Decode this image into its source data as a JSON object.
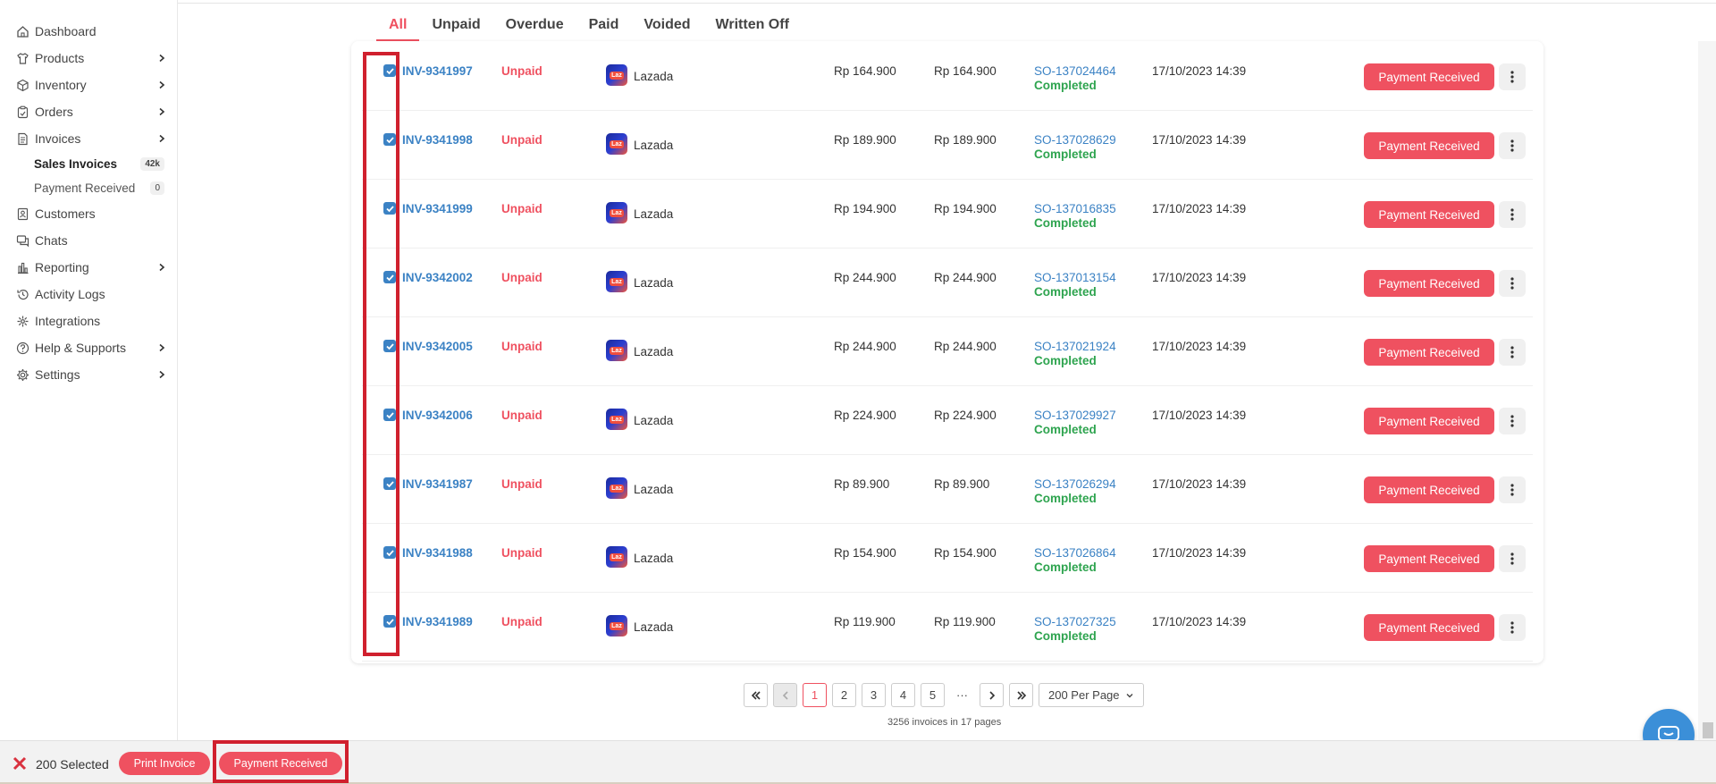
{
  "sidebar": {
    "items": [
      {
        "label": "Dashboard",
        "icon": "home-icon",
        "chevron": false
      },
      {
        "label": "Products",
        "icon": "shirt-icon",
        "chevron": true
      },
      {
        "label": "Inventory",
        "icon": "box-icon",
        "chevron": true
      },
      {
        "label": "Orders",
        "icon": "clipboard-icon",
        "chevron": true
      },
      {
        "label": "Invoices",
        "icon": "document-icon",
        "chevron": true
      }
    ],
    "sub_items": [
      {
        "label": "Sales Invoices",
        "badge": "42k"
      },
      {
        "label": "Payment Received",
        "badge": "0"
      }
    ],
    "items_after": [
      {
        "label": "Customers",
        "icon": "contact-icon",
        "chevron": false
      },
      {
        "label": "Chats",
        "icon": "chat-icon",
        "chevron": false
      },
      {
        "label": "Reporting",
        "icon": "bar-chart-icon",
        "chevron": true
      },
      {
        "label": "Activity Logs",
        "icon": "history-icon",
        "chevron": false
      },
      {
        "label": "Integrations",
        "icon": "integrations-icon",
        "chevron": false
      },
      {
        "label": "Help & Supports",
        "icon": "help-icon",
        "chevron": true
      },
      {
        "label": "Settings",
        "icon": "gear-icon",
        "chevron": true
      }
    ]
  },
  "tabs": [
    "All",
    "Unpaid",
    "Overdue",
    "Paid",
    "Voided",
    "Written Off"
  ],
  "rows": [
    {
      "invoice": "INV-9341997",
      "status": "Unpaid",
      "channel": "Lazada",
      "amount": "Rp 164.900",
      "balance": "Rp 164.900",
      "so": "SO-137024464",
      "so_status": "Completed",
      "date": "17/10/2023 14:39",
      "action": "Payment Received"
    },
    {
      "invoice": "INV-9341998",
      "status": "Unpaid",
      "channel": "Lazada",
      "amount": "Rp 189.900",
      "balance": "Rp 189.900",
      "so": "SO-137028629",
      "so_status": "Completed",
      "date": "17/10/2023 14:39",
      "action": "Payment Received"
    },
    {
      "invoice": "INV-9341999",
      "status": "Unpaid",
      "channel": "Lazada",
      "amount": "Rp 194.900",
      "balance": "Rp 194.900",
      "so": "SO-137016835",
      "so_status": "Completed",
      "date": "17/10/2023 14:39",
      "action": "Payment Received"
    },
    {
      "invoice": "INV-9342002",
      "status": "Unpaid",
      "channel": "Lazada",
      "amount": "Rp 244.900",
      "balance": "Rp 244.900",
      "so": "SO-137013154",
      "so_status": "Completed",
      "date": "17/10/2023 14:39",
      "action": "Payment Received"
    },
    {
      "invoice": "INV-9342005",
      "status": "Unpaid",
      "channel": "Lazada",
      "amount": "Rp 244.900",
      "balance": "Rp 244.900",
      "so": "SO-137021924",
      "so_status": "Completed",
      "date": "17/10/2023 14:39",
      "action": "Payment Received"
    },
    {
      "invoice": "INV-9342006",
      "status": "Unpaid",
      "channel": "Lazada",
      "amount": "Rp 224.900",
      "balance": "Rp 224.900",
      "so": "SO-137029927",
      "so_status": "Completed",
      "date": "17/10/2023 14:39",
      "action": "Payment Received"
    },
    {
      "invoice": "INV-9341987",
      "status": "Unpaid",
      "channel": "Lazada",
      "amount": "Rp 89.900",
      "balance": "Rp 89.900",
      "so": "SO-137026294",
      "so_status": "Completed",
      "date": "17/10/2023 14:39",
      "action": "Payment Received"
    },
    {
      "invoice": "INV-9341988",
      "status": "Unpaid",
      "channel": "Lazada",
      "amount": "Rp 154.900",
      "balance": "Rp 154.900",
      "so": "SO-137026864",
      "so_status": "Completed",
      "date": "17/10/2023 14:39",
      "action": "Payment Received"
    },
    {
      "invoice": "INV-9341989",
      "status": "Unpaid",
      "channel": "Lazada",
      "amount": "Rp 119.900",
      "balance": "Rp 119.900",
      "so": "SO-137027325",
      "so_status": "Completed",
      "date": "17/10/2023 14:39",
      "action": "Payment Received"
    }
  ],
  "channel_logo_text": "Laz",
  "pagination": {
    "pages": [
      "1",
      "2",
      "3",
      "4",
      "5"
    ],
    "current": "1",
    "ellipsis": "···",
    "per_page": "200 Per Page",
    "summary": "3256 invoices in 17 pages"
  },
  "bulk_bar": {
    "selected": "200 Selected",
    "print_label": "Print Invoice",
    "payment_label": "Payment Received"
  },
  "colors": {
    "accent": "#ef5160",
    "link": "#3b82c4",
    "success": "#2ea44f",
    "highlight": "#d0202e"
  }
}
